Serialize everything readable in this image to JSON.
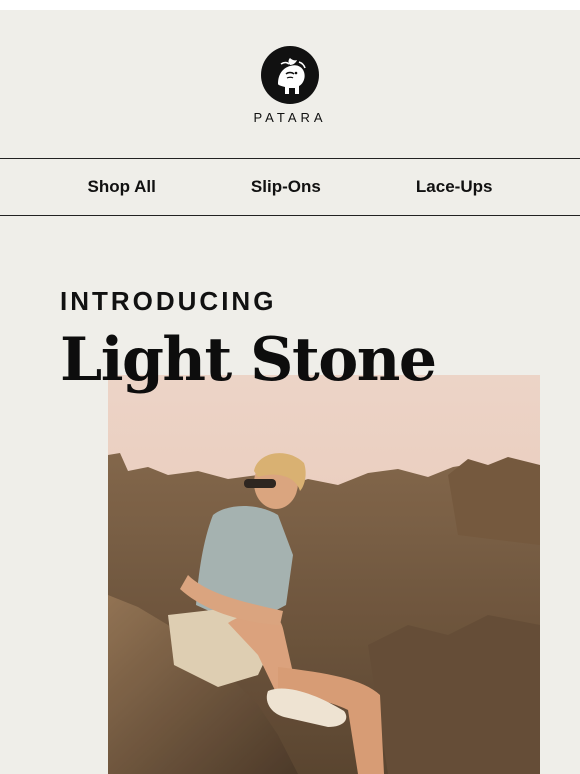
{
  "brand": {
    "name": "PATARA",
    "logo_icon": "elephant-emblem-icon"
  },
  "nav": {
    "items": [
      {
        "label": "Shop All"
      },
      {
        "label": "Slip-Ons"
      },
      {
        "label": "Lace-Ups"
      }
    ]
  },
  "hero": {
    "eyebrow": "INTRODUCING",
    "title": "Light Stone",
    "image": "man-sitting-on-rocks-photo"
  },
  "colors": {
    "background": "#efeee9",
    "text": "#111111",
    "sky": "#e9cfc3",
    "rock": "#6a5237"
  }
}
